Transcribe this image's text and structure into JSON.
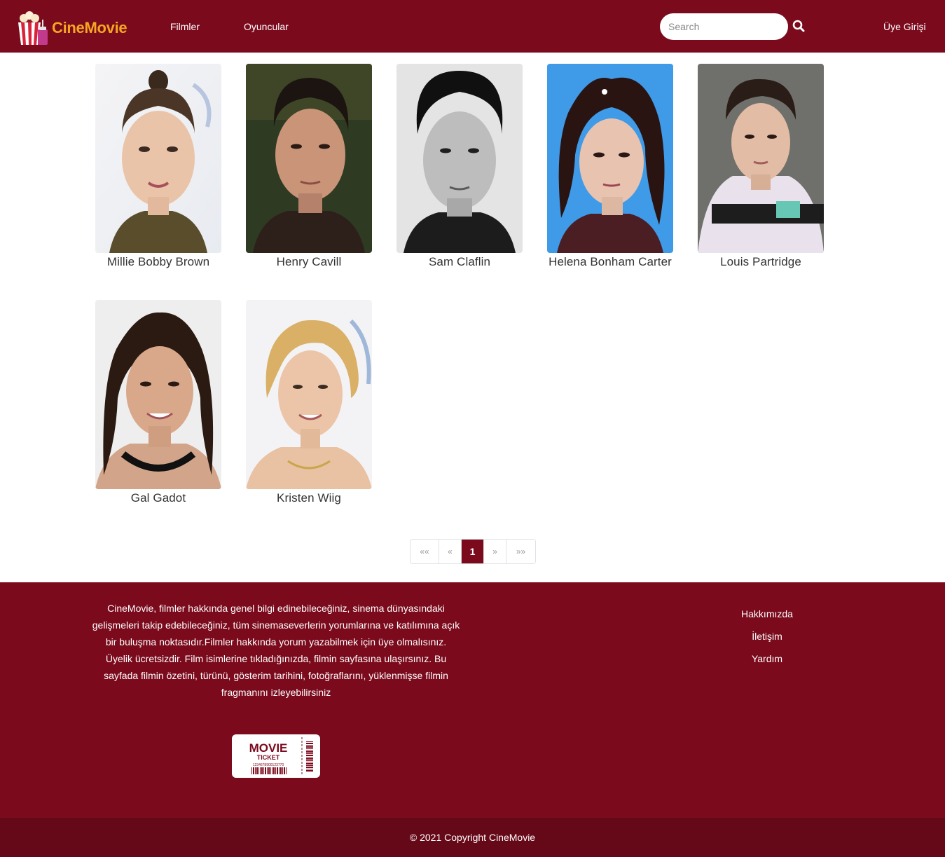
{
  "brand": {
    "name": "CineMovie",
    "logo_icon": "popcorn-icon"
  },
  "nav": {
    "films_label": "Filmler",
    "actors_label": "Oyuncular",
    "search_placeholder": "Search",
    "search_icon": "search-icon",
    "login_label": "Üye Girişi"
  },
  "actors": [
    {
      "name": "Millie Bobby Brown"
    },
    {
      "name": "Henry Cavill"
    },
    {
      "name": "Sam Claflin"
    },
    {
      "name": "Helena Bonham Carter"
    },
    {
      "name": "Louis Partridge"
    },
    {
      "name": "Gal Gadot"
    },
    {
      "name": "Kristen Wiig"
    }
  ],
  "pagination": {
    "first": "««",
    "prev": "«",
    "current": "1",
    "next": "»",
    "last": "»»"
  },
  "footer": {
    "about_text": "CineMovie, filmler hakkında genel bilgi edinebileceğiniz, sinema dünyasındaki gelişmeleri takip edebileceğiniz, tüm sinemaseverlerin yorumlarına ve katılımına açık bir buluşma noktasıdır.Filmler hakkında yorum yazabilmek için üye olmalısınız. Üyelik ücretsizdir. Film isimlerine tıkladığınızda, filmin sayfasına ulaşırsınız. Bu sayfada filmin özetini, türünü, gösterim tarihini, fotoğraflarını, yüklenmişse filmin fragmanını izleyebilirsiniz",
    "links": [
      "Hakkımızda",
      "İletişim",
      "Yardım"
    ],
    "ticket": {
      "title": "MOVIE",
      "subtitle": "TICKET",
      "code": "1234678900123770"
    },
    "copyright": "© 2021 Copyright CineMovie"
  },
  "colors": {
    "primary": "#7a0a1c",
    "dark": "#650817",
    "accent": "#f5a623"
  }
}
